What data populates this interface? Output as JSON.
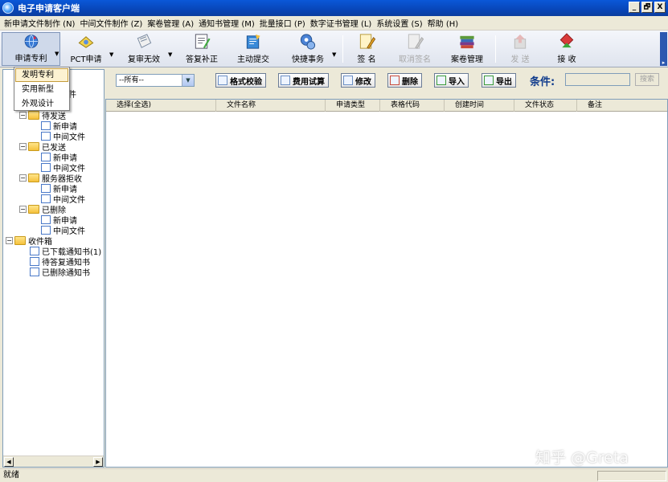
{
  "window": {
    "title": "电子申请客户端",
    "controls": [
      "_",
      "🗗",
      "X"
    ]
  },
  "menubar": [
    "新申请文件制作 (N)",
    "中间文件制作 (Z)",
    "案卷管理 (A)",
    "通知书管理 (M)",
    "批量接口 (P)",
    "数字证书管理 (L)",
    "系统设置 (S)",
    "帮助 (H)"
  ],
  "toolbar": {
    "buttons": [
      {
        "label": "申请专利",
        "icon": "globe-icon",
        "dropdown": true
      },
      {
        "label": "PCT申请",
        "icon": "eye-icon",
        "dropdown": true
      },
      {
        "label": "复审无效",
        "icon": "document-icon",
        "dropdown": true
      },
      {
        "label": "答复补正",
        "icon": "edit-icon"
      },
      {
        "label": "主动提交",
        "icon": "submit-icon"
      },
      {
        "label": "快捷事务",
        "icon": "gears-icon",
        "dropdown": true
      },
      {
        "label": "签 名",
        "icon": "sign-icon"
      },
      {
        "label": "取消签名",
        "icon": "unsign-icon",
        "disabled": true
      },
      {
        "label": "案卷管理",
        "icon": "books-icon"
      },
      {
        "label": "发 送",
        "icon": "send-icon",
        "disabled": true
      },
      {
        "label": "接 收",
        "icon": "receive-icon"
      }
    ],
    "more": "▸"
  },
  "popup_menu": {
    "items": [
      "发明专利",
      "实用新型",
      "外观设计"
    ],
    "highlighted": "发明专利"
  },
  "tree": {
    "partial_label": "件",
    "nodes": [
      {
        "label": "待发送",
        "level": 1,
        "type": "folder",
        "expander": "⊟"
      },
      {
        "label": "新申请",
        "level": 2,
        "type": "doc"
      },
      {
        "label": "中间文件",
        "level": 2,
        "type": "doc"
      },
      {
        "label": "已发送",
        "level": 1,
        "type": "folder",
        "expander": "⊟"
      },
      {
        "label": "新申请",
        "level": 2,
        "type": "doc"
      },
      {
        "label": "中间文件",
        "level": 2,
        "type": "doc"
      },
      {
        "label": "服务器拒收",
        "level": 1,
        "type": "folder",
        "expander": "⊟"
      },
      {
        "label": "新申请",
        "level": 2,
        "type": "doc"
      },
      {
        "label": "中间文件",
        "level": 2,
        "type": "doc"
      },
      {
        "label": "已删除",
        "level": 1,
        "type": "folder",
        "expander": "⊟"
      },
      {
        "label": "新申请",
        "level": 2,
        "type": "doc"
      },
      {
        "label": "中间文件",
        "level": 2,
        "type": "doc"
      },
      {
        "label": "收件箱",
        "level": 0,
        "type": "folder",
        "expander": "⊟"
      },
      {
        "label": "已下载通知书(1)",
        "level": 1,
        "type": "doc"
      },
      {
        "label": "待答复通知书",
        "level": 1,
        "type": "doc"
      },
      {
        "label": "已删除通知书",
        "level": 1,
        "type": "doc"
      }
    ]
  },
  "filter": {
    "select_value": "--所有--",
    "buttons": [
      "格式校验",
      "费用试算",
      "修改",
      "删除",
      "导入",
      "导出"
    ],
    "condition_label": "条件:",
    "condition_value": "",
    "search_label": "搜索"
  },
  "grid": {
    "columns": [
      "选择(全选)",
      "文件名称",
      "申请类型",
      "表格代码",
      "创建时间",
      "文件状态",
      "备注"
    ],
    "rows": []
  },
  "status": {
    "text": "就绪"
  },
  "watermark": "知乎 @Greta",
  "colors": {
    "titlebar": "#0a58d8",
    "accent": "#0f3b8c",
    "background": "#ece9d8"
  }
}
